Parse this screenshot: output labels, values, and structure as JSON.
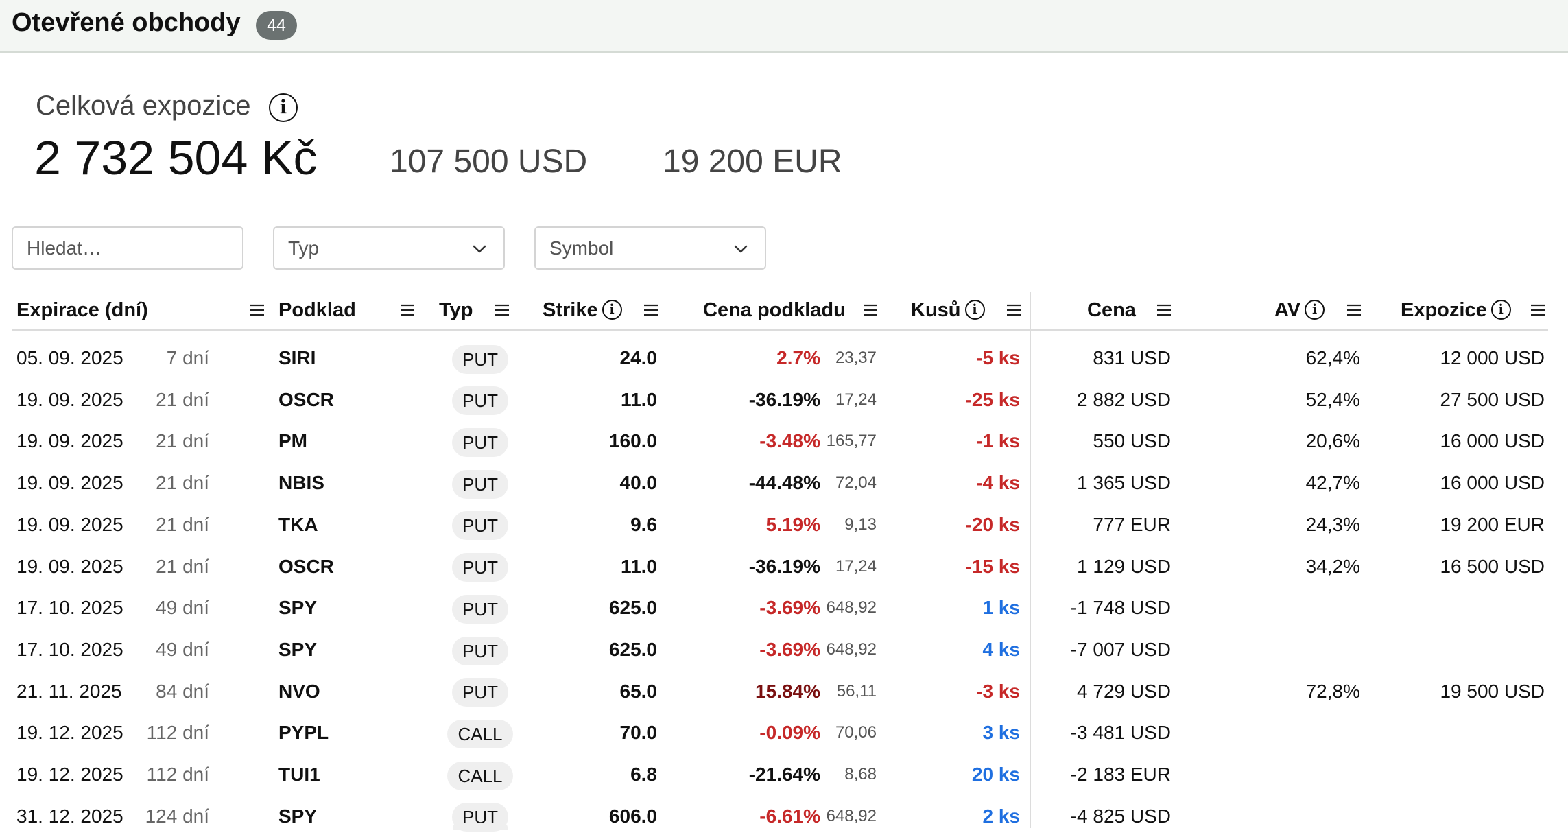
{
  "header": {
    "title": "Otevřené obchody",
    "count": "44"
  },
  "summary": {
    "label": "Celková expozice",
    "total_czk": "2 732 504 Kč",
    "total_usd": "107 500 USD",
    "total_eur": "19 200 EUR"
  },
  "filters": {
    "search_placeholder": "Hledat…",
    "type_placeholder": "Typ",
    "symbol_placeholder": "Symbol"
  },
  "columns": {
    "expiration": "Expirace (dní)",
    "underlying": "Podklad",
    "type": "Typ",
    "strike": "Strike",
    "underlying_price": "Cena podkladu",
    "quantity": "Kusů",
    "price": "Cena",
    "av": "AV",
    "exposure": "Expozice"
  },
  "colors": {
    "negative": "#c62828",
    "negative_dark": "#7a1010",
    "positive_qty": "#1f6fe0",
    "badge": "#6b7271",
    "topbar": "#f3f6f3"
  },
  "rows": [
    {
      "date": "05. 09. 2025",
      "days": "7 dní",
      "symbol": "SIRI",
      "type": "PUT",
      "strike": "24.0",
      "pct": "2.7%",
      "pct_tone": "red",
      "uprice": "23,37",
      "qty": "-5 ks",
      "qty_tone": "red",
      "price": "831 USD",
      "av": "62,4%",
      "exposure": "12 000 USD"
    },
    {
      "date": "19. 09. 2025",
      "days": "21 dní",
      "symbol": "OSCR",
      "type": "PUT",
      "strike": "11.0",
      "pct": "-36.19%",
      "pct_tone": "dark",
      "uprice": "17,24",
      "qty": "-25 ks",
      "qty_tone": "red",
      "price": "2 882 USD",
      "av": "52,4%",
      "exposure": "27 500 USD"
    },
    {
      "date": "19. 09. 2025",
      "days": "21 dní",
      "symbol": "PM",
      "type": "PUT",
      "strike": "160.0",
      "pct": "-3.48%",
      "pct_tone": "red",
      "uprice": "165,77",
      "qty": "-1 ks",
      "qty_tone": "red",
      "price": "550 USD",
      "av": "20,6%",
      "exposure": "16 000 USD"
    },
    {
      "date": "19. 09. 2025",
      "days": "21 dní",
      "symbol": "NBIS",
      "type": "PUT",
      "strike": "40.0",
      "pct": "-44.48%",
      "pct_tone": "dark",
      "uprice": "72,04",
      "qty": "-4 ks",
      "qty_tone": "red",
      "price": "1 365 USD",
      "av": "42,7%",
      "exposure": "16 000 USD"
    },
    {
      "date": "19. 09. 2025",
      "days": "21 dní",
      "symbol": "TKA",
      "type": "PUT",
      "strike": "9.6",
      "pct": "5.19%",
      "pct_tone": "red",
      "uprice": "9,13",
      "qty": "-20 ks",
      "qty_tone": "red",
      "price": "777 EUR",
      "av": "24,3%",
      "exposure": "19 200 EUR"
    },
    {
      "date": "19. 09. 2025",
      "days": "21 dní",
      "symbol": "OSCR",
      "type": "PUT",
      "strike": "11.0",
      "pct": "-36.19%",
      "pct_tone": "dark",
      "uprice": "17,24",
      "qty": "-15 ks",
      "qty_tone": "red",
      "price": "1 129 USD",
      "av": "34,2%",
      "exposure": "16 500 USD"
    },
    {
      "date": "17. 10. 2025",
      "days": "49 dní",
      "symbol": "SPY",
      "type": "PUT",
      "strike": "625.0",
      "pct": "-3.69%",
      "pct_tone": "red",
      "uprice": "648,92",
      "qty": "1 ks",
      "qty_tone": "blue",
      "price": "-1 748 USD",
      "av": "",
      "exposure": ""
    },
    {
      "date": "17. 10. 2025",
      "days": "49 dní",
      "symbol": "SPY",
      "type": "PUT",
      "strike": "625.0",
      "pct": "-3.69%",
      "pct_tone": "red",
      "uprice": "648,92",
      "qty": "4 ks",
      "qty_tone": "blue",
      "price": "-7 007 USD",
      "av": "",
      "exposure": ""
    },
    {
      "date": "21. 11. 2025",
      "days": "84 dní",
      "symbol": "NVO",
      "type": "PUT",
      "strike": "65.0",
      "pct": "15.84%",
      "pct_tone": "darkred",
      "uprice": "56,11",
      "qty": "-3 ks",
      "qty_tone": "red",
      "price": "4 729 USD",
      "av": "72,8%",
      "exposure": "19 500 USD"
    },
    {
      "date": "19. 12. 2025",
      "days": "112 dní",
      "symbol": "PYPL",
      "type": "CALL",
      "strike": "70.0",
      "pct": "-0.09%",
      "pct_tone": "red",
      "uprice": "70,06",
      "qty": "3 ks",
      "qty_tone": "blue",
      "price": "-3 481 USD",
      "av": "",
      "exposure": ""
    },
    {
      "date": "19. 12. 2025",
      "days": "112 dní",
      "symbol": "TUI1",
      "type": "CALL",
      "strike": "6.8",
      "pct": "-21.64%",
      "pct_tone": "dark",
      "uprice": "8,68",
      "qty": "20 ks",
      "qty_tone": "blue",
      "price": "-2 183 EUR",
      "av": "",
      "exposure": ""
    },
    {
      "date": "31. 12. 2025",
      "days": "124 dní",
      "symbol": "SPY",
      "type": "PUT",
      "strike": "606.0",
      "pct": "-6.61%",
      "pct_tone": "red",
      "uprice": "648,92",
      "qty": "2 ks",
      "qty_tone": "blue",
      "price": "-4 825 USD",
      "av": "",
      "exposure": ""
    }
  ]
}
